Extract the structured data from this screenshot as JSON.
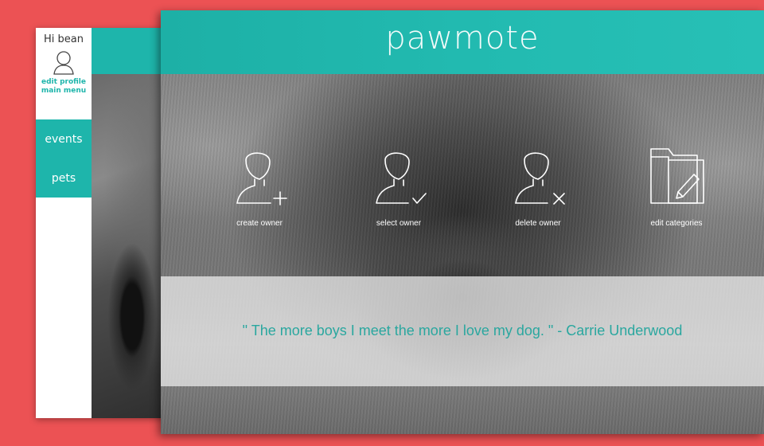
{
  "sidebar": {
    "greeting": "Hi bean",
    "edit_profile": "edit profile",
    "main_menu": "main menu",
    "items": [
      {
        "label": "events"
      },
      {
        "label": "pets"
      }
    ]
  },
  "header": {
    "logo": "pawmote"
  },
  "tools": [
    {
      "label": "create owner",
      "icon": "user-add-icon"
    },
    {
      "label": "select owner",
      "icon": "user-check-icon"
    },
    {
      "label": "delete owner",
      "icon": "user-remove-icon"
    },
    {
      "label": "edit categories",
      "icon": "folder-edit-icon"
    }
  ],
  "quote": {
    "text": "\" The more boys I meet the more I love my dog. \" - Carrie Underwood"
  },
  "colors": {
    "background": "#ec5254",
    "accent": "#1eb5ab",
    "quote_text": "#2aa79f"
  }
}
